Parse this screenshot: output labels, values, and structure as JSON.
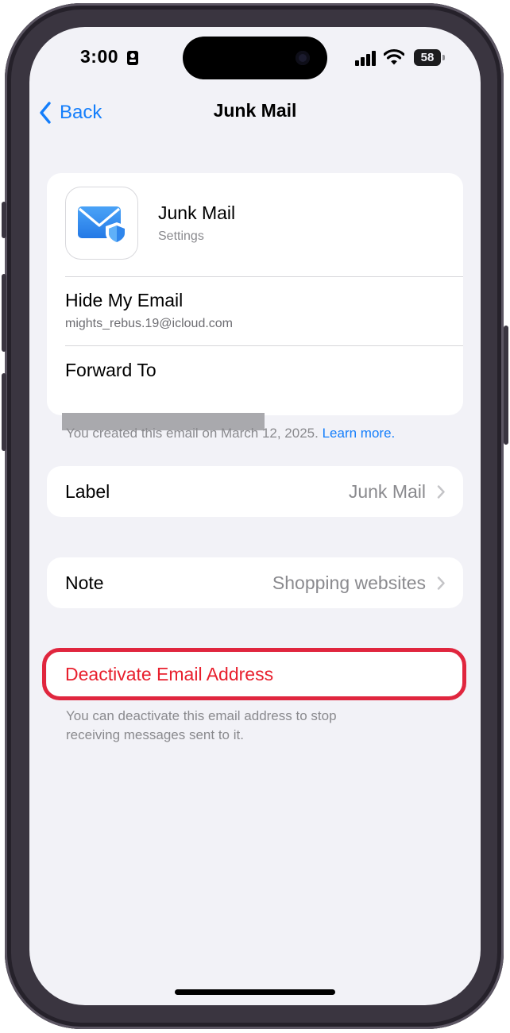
{
  "status_bar": {
    "time": "3:00",
    "battery": "58"
  },
  "nav": {
    "back_label": "Back",
    "title": "Junk Mail"
  },
  "header_card": {
    "app_name": "Junk Mail",
    "app_subtitle": "Settings",
    "hide_my_email_title": "Hide My Email",
    "hide_my_email_value": "mights_rebus.19@icloud.com",
    "forward_to_title": "Forward To",
    "forward_to_value": "redacted"
  },
  "created_note": {
    "text": "You created this email on March 12, 2025.",
    "link": "Learn more."
  },
  "label_row": {
    "label": "Label",
    "value": "Junk Mail"
  },
  "note_row": {
    "label": "Note",
    "value": "Shopping websites"
  },
  "deactivate": {
    "label": "Deactivate Email Address",
    "footnote_line1": "You can deactivate this email address to stop",
    "footnote_line2": "receiving messages sent to it."
  },
  "colors": {
    "accent": "#147efb",
    "destructive": "#e8202e",
    "highlight": "#e0263e",
    "background": "#f2f2f7"
  },
  "icons": [
    "back-chevron-icon",
    "mail-shield-icon",
    "chevron-right-icon",
    "cellular-signal-icon",
    "wifi-icon",
    "battery-icon",
    "id-card-icon"
  ]
}
